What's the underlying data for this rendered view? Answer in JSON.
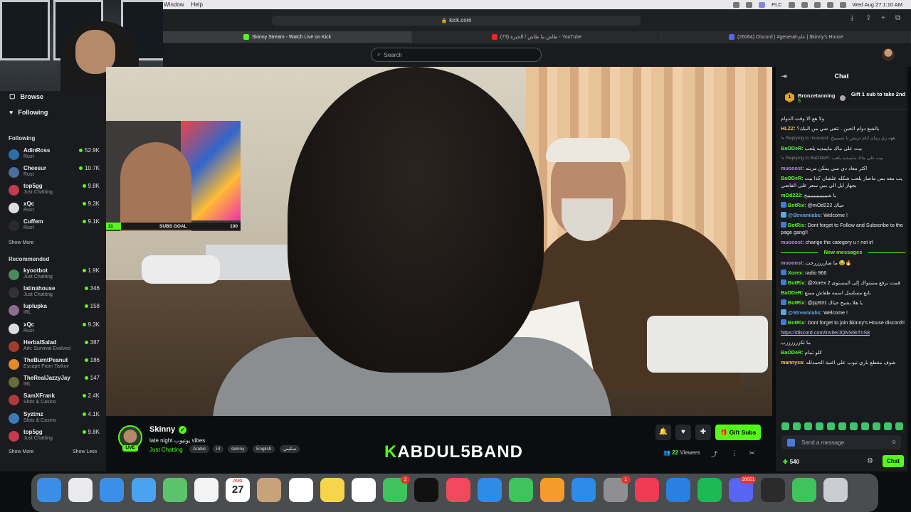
{
  "menubar": {
    "items": [
      "Window",
      "Help"
    ],
    "right": {
      "plc": "PLC",
      "datetime": "Wed Aug 27  1:10 AM"
    }
  },
  "browser": {
    "url": "kick.com",
    "tabs": [
      {
        "label": "Skinny Stream - Watch Live on Kick",
        "active": true
      },
      {
        "label": "(73) طاش ما طاش / الحيرة - YouTube",
        "active": false
      },
      {
        "label": "(26064) Discord | #general-عام | $kinny's House",
        "active": false
      }
    ]
  },
  "search": {
    "placeholder": "Search"
  },
  "sidebar": {
    "browse": "Browse",
    "following_nav": "Following",
    "following_title": "Following",
    "following": [
      {
        "name": "AdinRoss",
        "game": "Rust",
        "viewers": "52.9K",
        "color": "#2d6fa8"
      },
      {
        "name": "Cheesur",
        "game": "Rust",
        "viewers": "10.7K",
        "color": "#4c6e9e"
      },
      {
        "name": "top5gg",
        "game": "Just Chatting",
        "viewers": "9.8K",
        "color": "#c53a4d"
      },
      {
        "name": "xQc",
        "game": "Rust",
        "viewers": "9.3K",
        "color": "#dddddd"
      },
      {
        "name": "Cuffem",
        "game": "Rust",
        "viewers": "9.1K",
        "color": "#2b2b2b"
      }
    ],
    "show_more_1": "Show More",
    "recommended_title": "Recommended",
    "recommended": [
      {
        "name": "kyootbot",
        "game": "Just Chatting",
        "viewers": "1.9K",
        "color": "#4d8a5b"
      },
      {
        "name": "latinahouse",
        "game": "Just Chatting",
        "viewers": "346",
        "color": "#333333"
      },
      {
        "name": "luplupka",
        "game": "IRL",
        "viewers": "158",
        "color": "#8a6d8f"
      },
      {
        "name": "xQc",
        "game": "Rust",
        "viewers": "9.3K",
        "color": "#dddddd"
      },
      {
        "name": "HerbalSalad",
        "game": "Ark: Survival Evolved",
        "viewers": "387",
        "color": "#a33b2e"
      },
      {
        "name": "TheBurntPeanut",
        "game": "Escape From Tarkov",
        "viewers": "186",
        "color": "#e08a2a"
      },
      {
        "name": "TheRealJazzyJay",
        "game": "IRL",
        "viewers": "147",
        "color": "#6b6b3a"
      },
      {
        "name": "SamXFrank",
        "game": "Slots & Casino",
        "viewers": "2.4K",
        "color": "#b03a3a"
      },
      {
        "name": "Syztmz",
        "game": "Slots & Casino",
        "viewers": "4.1K",
        "color": "#3d7ab8"
      },
      {
        "name": "top5gg",
        "game": "Just Chatting",
        "viewers": "9.8K",
        "color": "#c53a4d"
      }
    ],
    "show_more_2": "Show More",
    "show_less": "Show Less"
  },
  "overlay": {
    "subs_goal_label": "SUBS GOAL",
    "subs_current": "11",
    "subs_target": "100",
    "progress": 0.11
  },
  "stream": {
    "channel": "Skinny",
    "title": "late night يوتيوب vibes",
    "category": "Just Chatting",
    "tags": [
      "Arabic",
      "irl",
      "skinny",
      "English",
      "سكيني"
    ],
    "live": "LIVE",
    "brand_k": "K",
    "brand_rest": "ABDUL5BAND",
    "gift_subs": "Gift Subs",
    "viewers": "22",
    "viewers_label": "Viewers"
  },
  "chat": {
    "title": "Chat",
    "gifter": {
      "name": "Bronzetanning",
      "count": "5",
      "rank": "1",
      "cta": "Gift 1 sub to take 2nd"
    },
    "messages_before": [
      {
        "reply": "",
        "user": "",
        "color": "#eee",
        "text": "ولا هع الا وقت الدوام"
      },
      {
        "reply": "",
        "user": "HLZZ:",
        "color": "#f2c94c",
        "text": "بالشغ دوام الحين . تتغى شي من البنك؟"
      },
      {
        "reply": "↳ Replying to muooost: ههه زي زمان ايام تزيش يا شيييييخ",
        "user": "",
        "color": "#eee",
        "text": ""
      },
      {
        "reply": "",
        "user": "BaODeR:",
        "color": "#53fc18",
        "text": "بيت على ماك مايمديه يلعب"
      },
      {
        "reply": "↳ Replying to BaODeR: بيت على ماك مايمديه يلعب",
        "user": "",
        "color": "#eee",
        "text": ""
      },
      {
        "reply": "",
        "user": "muooost:",
        "color": "#b58ad8",
        "text": "اكثر معاد دي سي يمكن مزينه"
      },
      {
        "reply": "",
        "user": "BaODeR:",
        "color": "#53fc18",
        "text": "يب معه بس ماصار يلعب شكله علشان كذا بيت بجهاز ايل الي بس سعر على الفاضي"
      },
      {
        "reply": "",
        "user": "mOd222:",
        "color": "#53fc18",
        "text": "يا شيييييييييييييخ"
      },
      {
        "reply": "",
        "user": "BotRix:",
        "color": "#53fc18",
        "text": "@mOd222 حياك"
      },
      {
        "reply": "",
        "user": "@Streamlabs:",
        "color": "#5aa7e8",
        "text": "Welcome !"
      },
      {
        "reply": "",
        "user": "BotRix:",
        "color": "#53fc18",
        "text": "Dont forget to Follow and Subscribe to the page gang!!"
      },
      {
        "reply": "",
        "user": "muooost:",
        "color": "#b58ad8",
        "text": "change the category u r not irl"
      }
    ],
    "new_messages": "New messages",
    "messages_after": [
      {
        "user": "muooost:",
        "color": "#b58ad8",
        "text": "ما صارررزرخت 😂🔥"
      },
      {
        "user": "Xorex:",
        "color": "#53fc18",
        "text": "radio 966"
      },
      {
        "user": "BotRix:",
        "color": "#53fc18",
        "text": "@Xorex قمت برفع مستواك إلى المستوى 2"
      },
      {
        "user": "BaODeR:",
        "color": "#53fc18",
        "text": "تابع مسلسل اسمه طفاش ممتع"
      },
      {
        "user": "BotRix:",
        "color": "#53fc18",
        "text": "@pp931 يا هلا بشيخ حياك"
      },
      {
        "user": "@Streamlabs:",
        "color": "#5aa7e8",
        "text": "Welcome !"
      },
      {
        "user": "BotRix:",
        "color": "#53fc18",
        "text": "Dont forget to join $kinny's House discord!!"
      },
      {
        "user": "",
        "color": "#eee",
        "text": "https://discord.com/invite/JQNS6kTnS8",
        "link": true
      },
      {
        "user": "",
        "color": "#eee",
        "text": "ما تكززززززب"
      },
      {
        "user": "BaODeR:",
        "color": "#53fc18",
        "text": "كلو تمام"
      },
      {
        "user": "mannysa:",
        "color": "#f2c94c",
        "text": "شوف مقطع باري تيوب على اغنية الحمدلله"
      }
    ],
    "input_placeholder": "Send a message",
    "points": "540",
    "send": "Chat"
  },
  "dock": {
    "calendar_month": "AUG",
    "calendar_day": "27",
    "badges": {
      "facetime": "2",
      "settings": "1",
      "discord": "26051"
    },
    "apps": [
      {
        "name": "finder",
        "color": "#3a8ee6"
      },
      {
        "name": "launchpad",
        "color": "#e9e9ee"
      },
      {
        "name": "safari",
        "color": "#3b8fe8"
      },
      {
        "name": "mail",
        "color": "#4aa3f0"
      },
      {
        "name": "maps",
        "color": "#5bc36a"
      },
      {
        "name": "photos",
        "color": "#f3f3f3"
      },
      {
        "name": "calendar",
        "color": "#ffffff"
      },
      {
        "name": "contacts",
        "color": "#c8a27a"
      },
      {
        "name": "reminders",
        "color": "#ffffff"
      },
      {
        "name": "notes",
        "color": "#f7d54a"
      },
      {
        "name": "freeform",
        "color": "#ffffff"
      },
      {
        "name": "facetime",
        "color": "#3ec45a"
      },
      {
        "name": "appletv",
        "color": "#111111"
      },
      {
        "name": "news",
        "color": "#f24a5a"
      },
      {
        "name": "keynote",
        "color": "#2f8ae8"
      },
      {
        "name": "numbers",
        "color": "#3ec45a"
      },
      {
        "name": "pages",
        "color": "#f49b2a"
      },
      {
        "name": "appstore",
        "color": "#2f8ae8"
      },
      {
        "name": "settings",
        "color": "#8e8e93"
      },
      {
        "name": "music",
        "color": "#f23a55"
      },
      {
        "name": "bluetooth",
        "color": "#2a7fe0"
      },
      {
        "name": "spotify",
        "color": "#1db954"
      },
      {
        "name": "discord",
        "color": "#5865f2"
      },
      {
        "name": "obs",
        "color": "#2b2b2b"
      },
      {
        "name": "messages",
        "color": "#3ec45a"
      },
      {
        "name": "trash",
        "color": "#c9ccd1"
      }
    ]
  }
}
